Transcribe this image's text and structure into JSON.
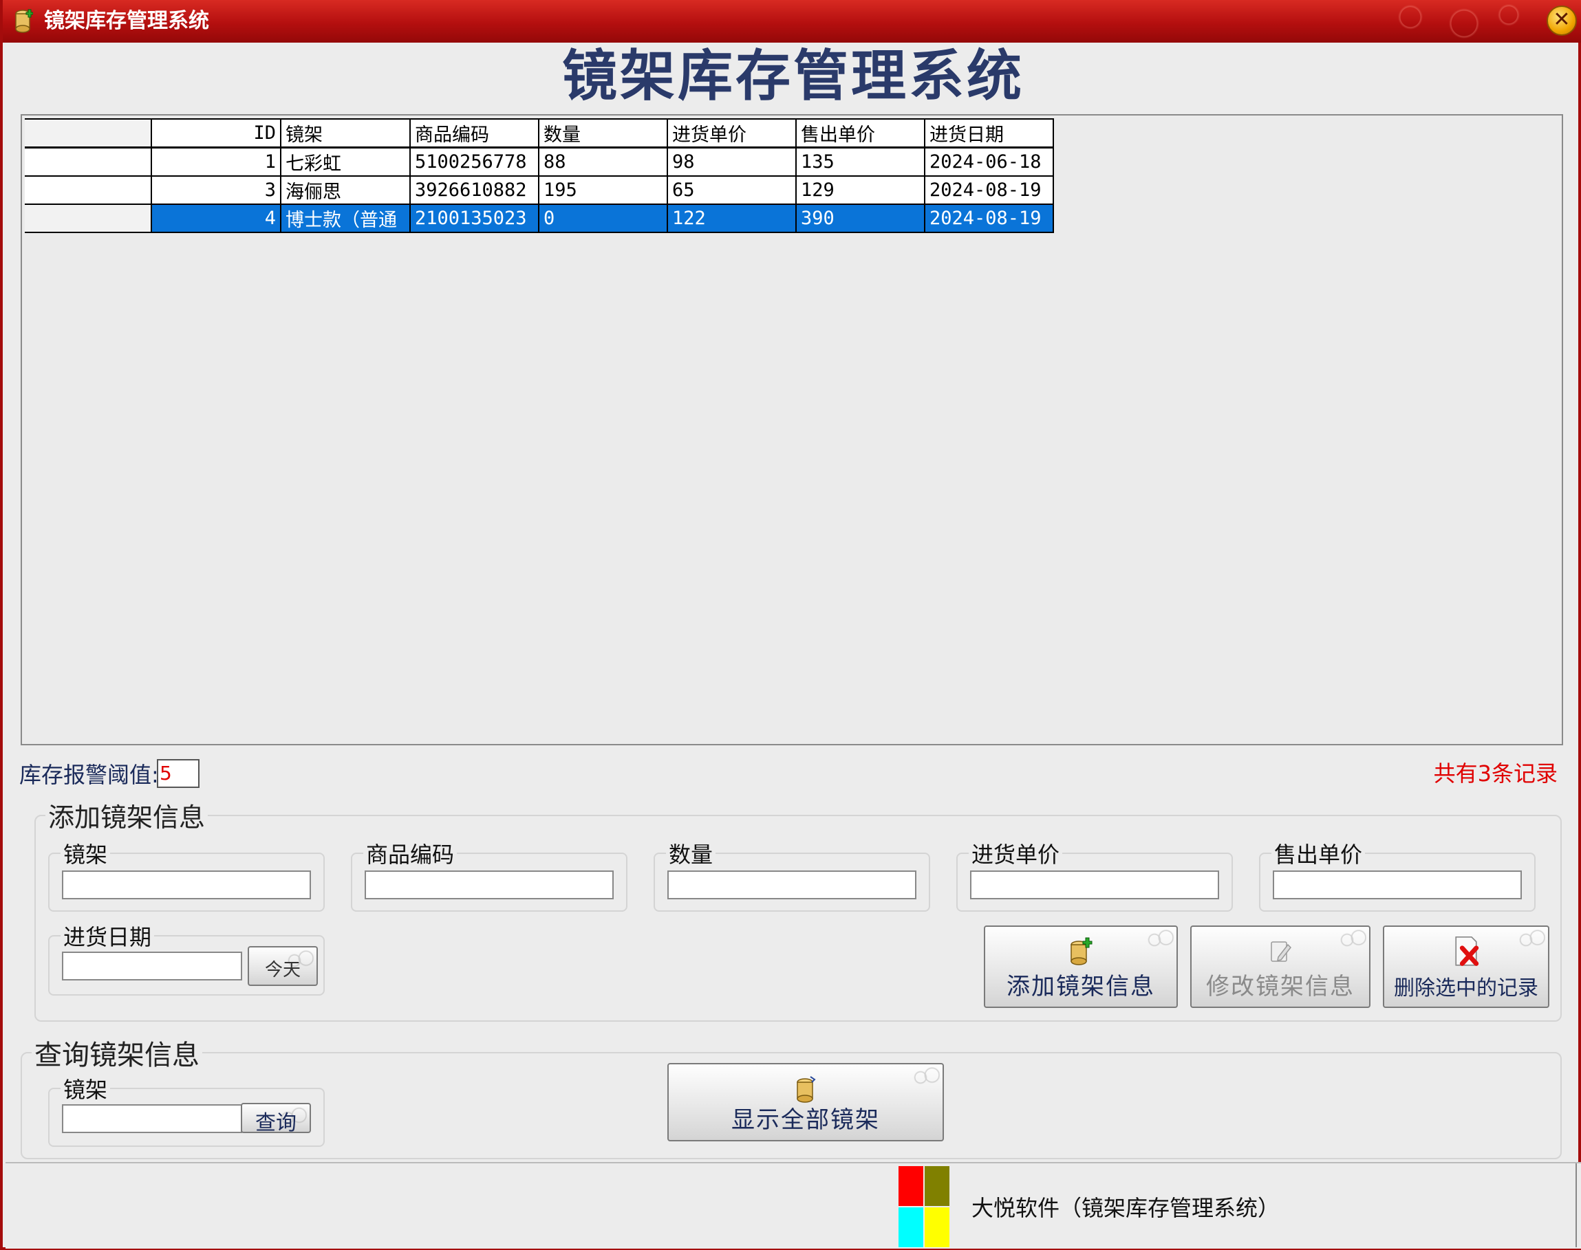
{
  "window": {
    "title": "镜架库存管理系统"
  },
  "heading": "镜架库存管理系统",
  "grid": {
    "columns": [
      "ID",
      "镜架",
      "商品编码",
      "数量",
      "进货单价",
      "售出单价",
      "进货日期"
    ],
    "rows": [
      {
        "id": "1",
        "name": "七彩虹",
        "code": "5100256778",
        "qty": "88",
        "buy": "98",
        "sell": "135",
        "date": "2024-06-18"
      },
      {
        "id": "3",
        "name": "海俪思",
        "code": "3926610882",
        "qty": "195",
        "buy": "65",
        "sell": "129",
        "date": "2024-08-19"
      },
      {
        "id": "4",
        "name": "博士款（普通",
        "code": "2100135023",
        "qty": "0",
        "buy": "122",
        "sell": "390",
        "date": "2024-08-19"
      }
    ]
  },
  "threshold": {
    "label": "库存报警阈值:",
    "value": "5"
  },
  "record_count": "共有3条记录",
  "add_section": {
    "title": "添加镜架信息",
    "frame_label": "镜架",
    "code_label": "商品编码",
    "qty_label": "数量",
    "buy_label": "进货单价",
    "sell_label": "售出单价",
    "date_label": "进货日期",
    "today_button": "今天",
    "add_button": "添加镜架信息",
    "edit_button": "修改镜架信息",
    "delete_button": "删除选中的记录"
  },
  "query_section": {
    "title": "查询镜架信息",
    "frame_label": "镜架",
    "query_button": "查询",
    "show_all_button": "显示全部镜架"
  },
  "status": {
    "text": "大悦软件（镜架库存管理系统）"
  },
  "colors": {
    "title_bar": "#c01a16",
    "selection": "#0a74d8",
    "alert_text": "#e00000",
    "heading": "#2a3a6a"
  }
}
